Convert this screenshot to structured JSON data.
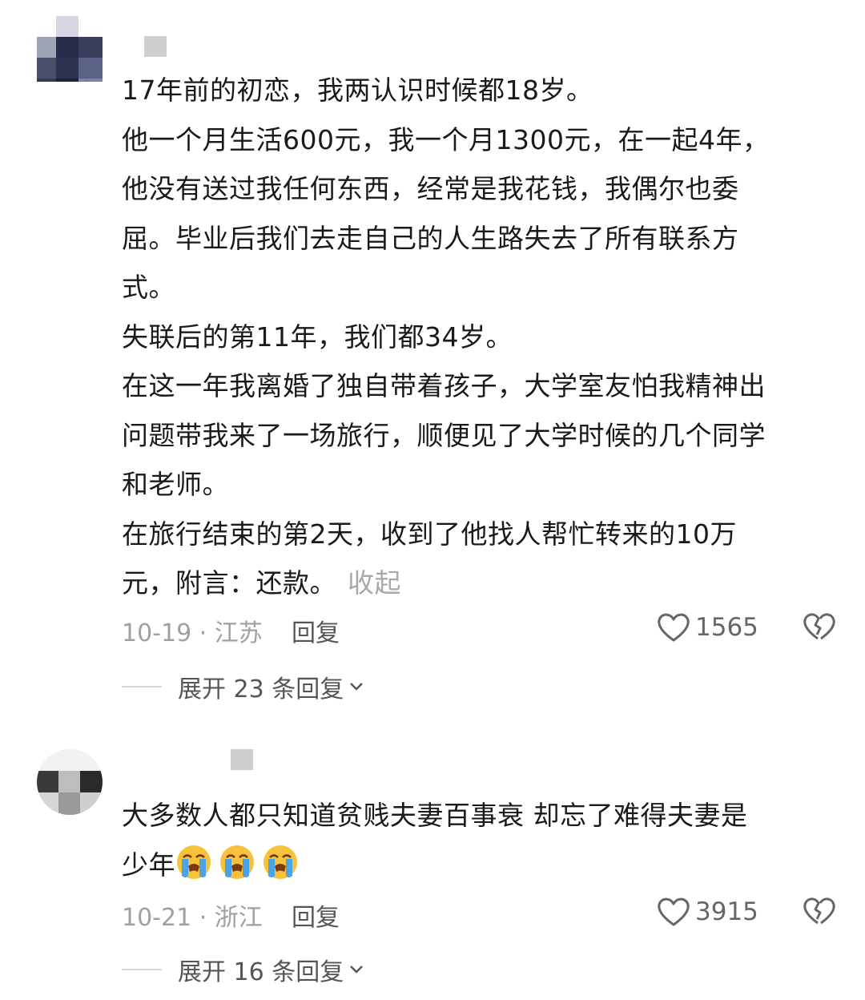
{
  "comments": [
    {
      "lines": [
        "17年前的初恋，我两认识时候都18岁。",
        "他一个月生活600元，我一个月1300元，在一起4年，",
        "他没有送过我任何东西，经常是我花钱，我偶尔也委",
        "屈。毕业后我们去走自己的人生路失去了所有联系方",
        "式。",
        "失联后的第11年，我们都34岁。",
        "在这一年我离婚了独自带着孩子，大学室友怕我精神出",
        "问题带我来了一场旅行，顺便见了大学时候的几个同学",
        "和老师。",
        "在旅行结束的第2天，收到了他找人帮忙转来的10万"
      ],
      "last_line": "元，附言：还款。",
      "collapse_label": "收起",
      "date_location": "10-19 · 江苏",
      "reply_label": "回复",
      "likes": "1565",
      "expand_label": "展开 23 条回复"
    },
    {
      "line1": "大多数人都只知道贫贱夫妻百事衰 却忘了难得夫妻是",
      "line2": "少年",
      "emojis": [
        "loudly-crying-face",
        "loudly-crying-face",
        "loudly-crying-face"
      ],
      "date_location": "10-21 · 浙江",
      "reply_label": "回复",
      "likes": "3915",
      "expand_label": "展开 16 条回复"
    }
  ],
  "icons": {
    "like": "heart-outline-icon",
    "dislike": "broken-heart-icon",
    "expand": "chevron-down-icon"
  }
}
